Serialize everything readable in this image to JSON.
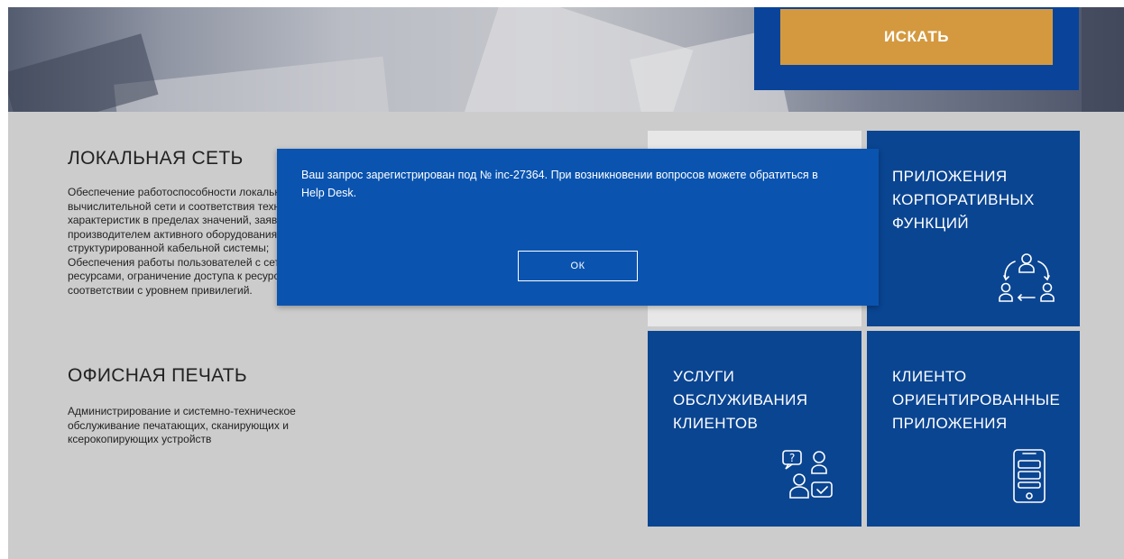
{
  "hero": {
    "search_button": "ИСКАТЬ"
  },
  "sections": {
    "local_network": {
      "title": "ЛОКАЛЬНАЯ СЕТЬ",
      "description": "Обеспечение работоспособности локальной вычислительной сети и соответствия технических характеристик в пределах значений, заявленных производителем активного оборудования и структурированной кабельной системы; Обеспечения работы пользователей с сетевыми ресурсами, ограничение доступа к ресурсам сети в соответствии с уровнем привилегий."
    },
    "office_print": {
      "title": "ОФИСНАЯ ПЕЧАТЬ",
      "description": "Администрирование и системно-техническое обслуживание печатающих, сканирующих и ксерокопирующих устройств"
    }
  },
  "tiles": {
    "top_right": {
      "line1": "ПРИЛОЖЕНИЯ",
      "line2": "КОРПОРАТИВНЫХ",
      "line3": "ФУНКЦИЙ",
      "icon": "org-cycle-icon"
    },
    "bottom_left": {
      "line1": "УСЛУГИ",
      "line2": "ОБСЛУЖИВАНИЯ",
      "line3": "КЛИЕНТОВ",
      "icon": "support-chat-icon"
    },
    "bottom_right": {
      "line1": "КЛИЕНТО",
      "line2": "ОРИЕНТИРОВАННЫЕ",
      "line3": "ПРИЛОЖЕНИЯ",
      "icon": "mobile-chat-icon"
    }
  },
  "dialog": {
    "message": "Ваш запрос зарегистрирован под № inc-27364. При возникновении вопросов можете обратиться в Help Desk.",
    "ok_label": "ОК"
  },
  "colors": {
    "primary_blue": "#0a4592",
    "dialog_blue": "#0a54b0",
    "accent_orange": "#d4993f",
    "page_gray": "#cccccc"
  }
}
